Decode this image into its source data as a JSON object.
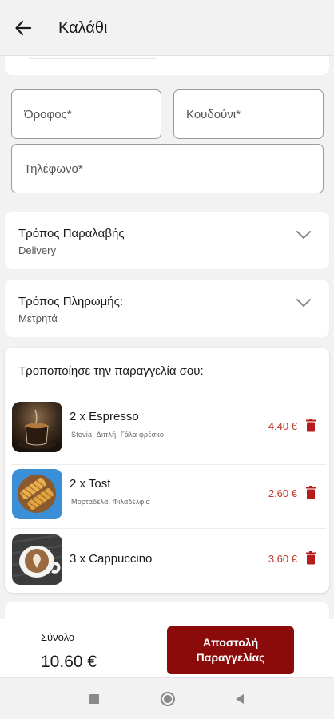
{
  "appbar": {
    "title": "Καλάθι",
    "back_icon": "arrow-left-icon"
  },
  "address_form": {
    "floor_placeholder": "Όροφος*",
    "floor_value": "",
    "doorbell_placeholder": "Κουδούνι*",
    "doorbell_value": "",
    "phone_placeholder": "Τηλέφωνο*",
    "phone_value": ""
  },
  "pickup": {
    "label": "Τρόπος Παραλαβής",
    "value": "Delivery",
    "icon": "chevron-down-icon"
  },
  "payment": {
    "label": "Τρόπος Πληρωμής:",
    "value": "Μετρητά",
    "icon": "chevron-down-icon"
  },
  "order": {
    "title": "Τροποποίησε την παραγγελία σου:",
    "items": [
      {
        "name": "2 x Espresso",
        "extras": "Stevia,  Διπλή,  Γάλα φρέσκο",
        "price": "4.40 €"
      },
      {
        "name": "2 x Tost",
        "extras": "Μορταδέλα,  Φιλαδέλφια",
        "price": "2.60 €"
      },
      {
        "name": "3 x Cappuccino",
        "extras": "",
        "price": "3.60 €"
      }
    ]
  },
  "footer": {
    "total_label": "Σύνολο",
    "total_value": "10.60 €",
    "submit_label": "Αποστολή Παραγγελίας"
  },
  "colors": {
    "accent": "#8b0b0b",
    "price": "#c0392b",
    "background": "#f2f2f2"
  }
}
